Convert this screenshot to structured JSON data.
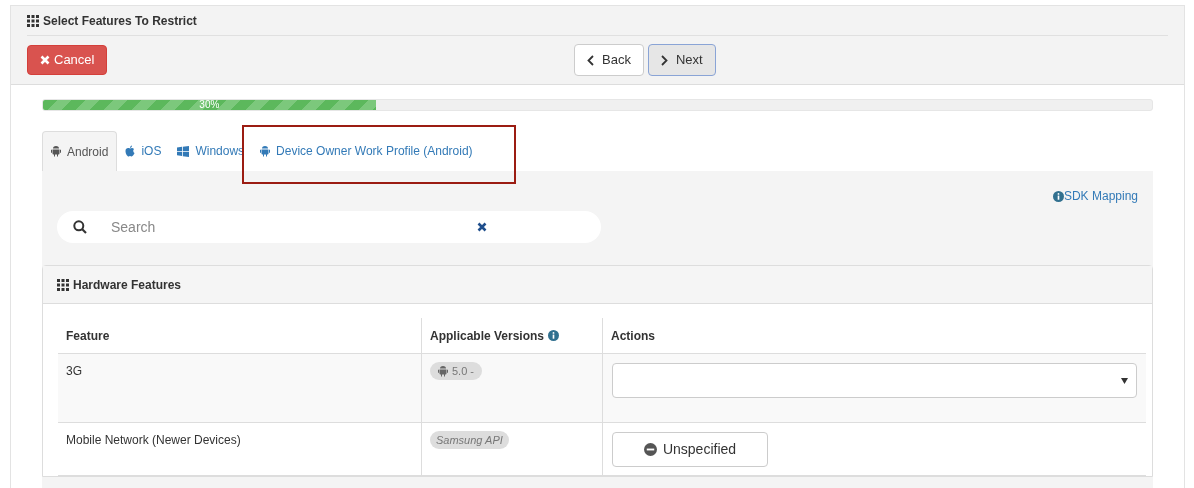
{
  "panel": {
    "title": "Select Features To Restrict"
  },
  "toolbar": {
    "cancel": "Cancel",
    "back": "Back",
    "next": "Next"
  },
  "progress": {
    "level": 0.3,
    "label": "30%"
  },
  "tabs": [
    {
      "label": "Android",
      "kind": "android",
      "selected": true,
      "highlighted": false
    },
    {
      "label": "iOS",
      "kind": "apple",
      "selected": false,
      "highlighted": false
    },
    {
      "label": "Windows",
      "kind": "windows",
      "selected": false,
      "highlighted": false
    },
    {
      "label": "Device Owner Work Profile (Android)",
      "kind": "android",
      "selected": false,
      "highlighted": true
    }
  ],
  "sdk_link": "SDK Mapping",
  "search": {
    "placeholder": "Search"
  },
  "section": {
    "title": "Hardware Features",
    "columns": [
      "Feature",
      "Applicable Versions",
      "Actions"
    ],
    "rows": [
      {
        "feature": "3G",
        "version": {
          "kind": "android",
          "text": "5.0 -"
        },
        "action": {
          "kind": "select"
        }
      },
      {
        "feature": "Mobile Network (Newer Devices)",
        "version": {
          "kind": "api",
          "text": "Samsung API"
        },
        "action": {
          "kind": "button",
          "label": "Unspecified"
        }
      }
    ]
  }
}
